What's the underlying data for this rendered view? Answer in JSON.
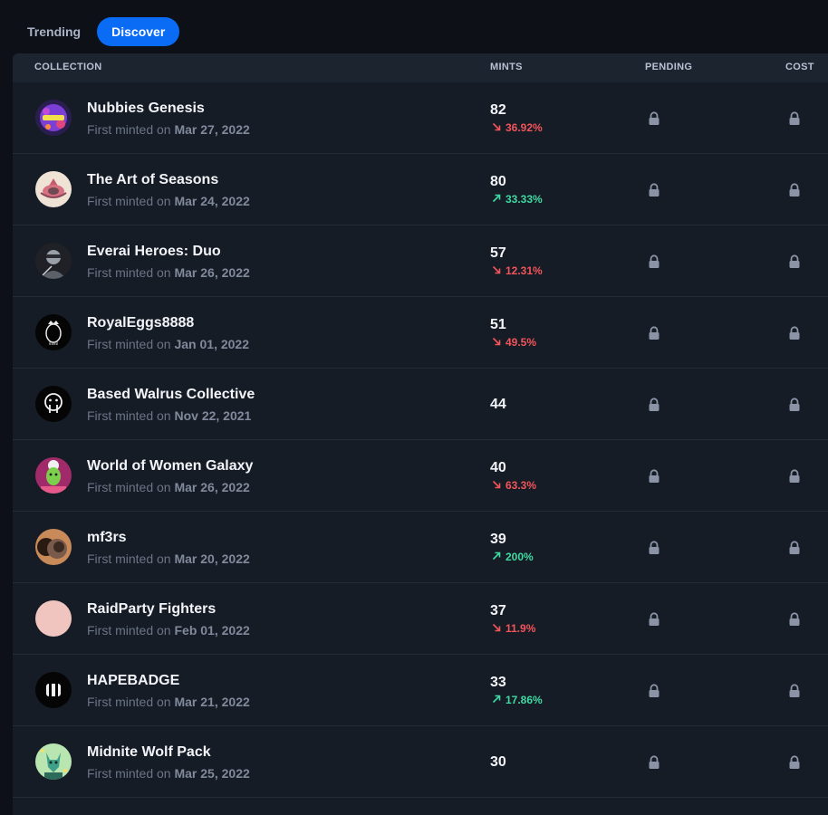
{
  "tabs": [
    {
      "label": "Trending",
      "active": false
    },
    {
      "label": "Discover",
      "active": true
    }
  ],
  "table": {
    "headers": {
      "collection": "COLLECTION",
      "mints": "MINTS",
      "pending": "PENDING",
      "cost": "COST"
    },
    "first_minted_prefix": "First minted on",
    "rows": [
      {
        "name": "Nubbies Genesis",
        "date": "Mar 27, 2022",
        "mints": "82",
        "change": "36.92%",
        "direction": "down",
        "avatar": "nubbies-avatar"
      },
      {
        "name": "The Art of Seasons",
        "date": "Mar 24, 2022",
        "mints": "80",
        "change": "33.33%",
        "direction": "up",
        "avatar": "art-of-seasons-avatar"
      },
      {
        "name": "Everai Heroes: Duo",
        "date": "Mar 26, 2022",
        "mints": "57",
        "change": "12.31%",
        "direction": "down",
        "avatar": "everai-avatar"
      },
      {
        "name": "RoyalEggs8888",
        "date": "Jan 01, 2022",
        "mints": "51",
        "change": "49.5%",
        "direction": "down",
        "avatar": "royaleggs-avatar"
      },
      {
        "name": "Based Walrus Collective",
        "date": "Nov 22, 2021",
        "mints": "44",
        "change": "",
        "direction": "none",
        "avatar": "walrus-avatar"
      },
      {
        "name": "World of Women Galaxy",
        "date": "Mar 26, 2022",
        "mints": "40",
        "change": "63.3%",
        "direction": "down",
        "avatar": "wow-galaxy-avatar"
      },
      {
        "name": "mf3rs",
        "date": "Mar 20, 2022",
        "mints": "39",
        "change": "200%",
        "direction": "up",
        "avatar": "mf3rs-avatar"
      },
      {
        "name": "RaidParty Fighters",
        "date": "Feb 01, 2022",
        "mints": "37",
        "change": "11.9%",
        "direction": "down",
        "avatar": "raidparty-avatar"
      },
      {
        "name": "HAPEBADGE",
        "date": "Mar 21, 2022",
        "mints": "33",
        "change": "17.86%",
        "direction": "up",
        "avatar": "hapebadge-avatar"
      },
      {
        "name": "Midnite Wolf Pack",
        "date": "Mar 25, 2022",
        "mints": "30",
        "change": "",
        "direction": "none",
        "avatar": "wolf-pack-avatar"
      }
    ]
  },
  "colors": {
    "accent": "#0a6cf5",
    "down": "#f2545b",
    "up": "#3fd9a3",
    "lock": "#8a94a6"
  },
  "icons": {
    "lock": "lock-icon",
    "trend_down": "arrow-down-right-icon",
    "trend_up": "arrow-up-right-icon"
  }
}
